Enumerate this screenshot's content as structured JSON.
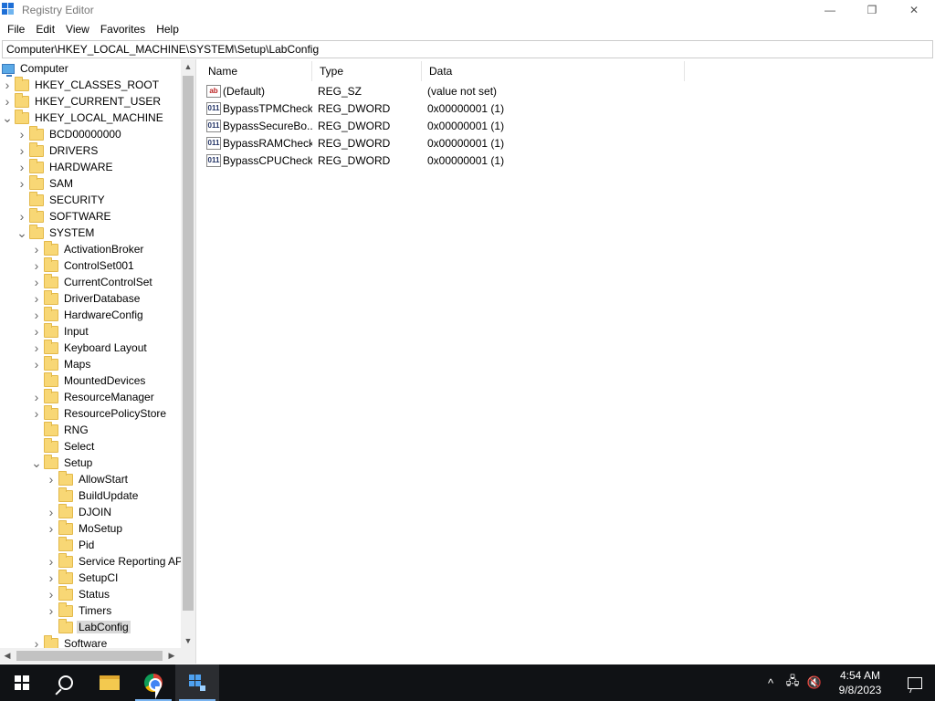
{
  "window": {
    "title": "Registry Editor",
    "minimize_glyph": "—",
    "maximize_glyph": "❐",
    "close_glyph": "✕"
  },
  "menu": [
    "File",
    "Edit",
    "View",
    "Favorites",
    "Help"
  ],
  "address": "Computer\\HKEY_LOCAL_MACHINE\\SYSTEM\\Setup\\LabConfig",
  "tree": [
    {
      "label": "Computer",
      "depth": 0,
      "icon": "computer-icon",
      "expander": "",
      "selected": false
    },
    {
      "label": "HKEY_CLASSES_ROOT",
      "depth": 1,
      "icon": "folder-icon",
      "expander": ">",
      "selected": false
    },
    {
      "label": "HKEY_CURRENT_USER",
      "depth": 1,
      "icon": "folder-icon",
      "expander": ">",
      "selected": false
    },
    {
      "label": "HKEY_LOCAL_MACHINE",
      "depth": 1,
      "icon": "folder-icon",
      "expander": "v",
      "selected": false
    },
    {
      "label": "BCD00000000",
      "depth": 2,
      "icon": "folder-icon",
      "expander": ">",
      "selected": false
    },
    {
      "label": "DRIVERS",
      "depth": 2,
      "icon": "folder-icon",
      "expander": ">",
      "selected": false
    },
    {
      "label": "HARDWARE",
      "depth": 2,
      "icon": "folder-icon",
      "expander": ">",
      "selected": false
    },
    {
      "label": "SAM",
      "depth": 2,
      "icon": "folder-icon",
      "expander": ">",
      "selected": false
    },
    {
      "label": "SECURITY",
      "depth": 2,
      "icon": "folder-icon",
      "expander": "",
      "selected": false
    },
    {
      "label": "SOFTWARE",
      "depth": 2,
      "icon": "folder-icon",
      "expander": ">",
      "selected": false
    },
    {
      "label": "SYSTEM",
      "depth": 2,
      "icon": "folder-icon",
      "expander": "v",
      "selected": false
    },
    {
      "label": "ActivationBroker",
      "depth": 3,
      "icon": "folder-icon",
      "expander": ">",
      "selected": false
    },
    {
      "label": "ControlSet001",
      "depth": 3,
      "icon": "folder-icon",
      "expander": ">",
      "selected": false
    },
    {
      "label": "CurrentControlSet",
      "depth": 3,
      "icon": "folder-icon",
      "expander": ">",
      "selected": false
    },
    {
      "label": "DriverDatabase",
      "depth": 3,
      "icon": "folder-icon",
      "expander": ">",
      "selected": false
    },
    {
      "label": "HardwareConfig",
      "depth": 3,
      "icon": "folder-icon",
      "expander": ">",
      "selected": false
    },
    {
      "label": "Input",
      "depth": 3,
      "icon": "folder-icon",
      "expander": ">",
      "selected": false
    },
    {
      "label": "Keyboard Layout",
      "depth": 3,
      "icon": "folder-icon",
      "expander": ">",
      "selected": false
    },
    {
      "label": "Maps",
      "depth": 3,
      "icon": "folder-icon",
      "expander": ">",
      "selected": false
    },
    {
      "label": "MountedDevices",
      "depth": 3,
      "icon": "folder-icon",
      "expander": "",
      "selected": false
    },
    {
      "label": "ResourceManager",
      "depth": 3,
      "icon": "folder-icon",
      "expander": ">",
      "selected": false
    },
    {
      "label": "ResourcePolicyStore",
      "depth": 3,
      "icon": "folder-icon",
      "expander": ">",
      "selected": false
    },
    {
      "label": "RNG",
      "depth": 3,
      "icon": "folder-icon",
      "expander": "",
      "selected": false
    },
    {
      "label": "Select",
      "depth": 3,
      "icon": "folder-icon",
      "expander": "",
      "selected": false
    },
    {
      "label": "Setup",
      "depth": 3,
      "icon": "folder-icon",
      "expander": "v",
      "selected": false
    },
    {
      "label": "AllowStart",
      "depth": 4,
      "icon": "folder-icon",
      "expander": ">",
      "selected": false
    },
    {
      "label": "BuildUpdate",
      "depth": 4,
      "icon": "folder-icon",
      "expander": "",
      "selected": false
    },
    {
      "label": "DJOIN",
      "depth": 4,
      "icon": "folder-icon",
      "expander": ">",
      "selected": false
    },
    {
      "label": "MoSetup",
      "depth": 4,
      "icon": "folder-icon",
      "expander": ">",
      "selected": false
    },
    {
      "label": "Pid",
      "depth": 4,
      "icon": "folder-icon",
      "expander": "",
      "selected": false
    },
    {
      "label": "Service Reporting API",
      "depth": 4,
      "icon": "folder-icon",
      "expander": ">",
      "selected": false
    },
    {
      "label": "SetupCI",
      "depth": 4,
      "icon": "folder-icon",
      "expander": ">",
      "selected": false
    },
    {
      "label": "Status",
      "depth": 4,
      "icon": "folder-icon",
      "expander": ">",
      "selected": false
    },
    {
      "label": "Timers",
      "depth": 4,
      "icon": "folder-icon",
      "expander": ">",
      "selected": false
    },
    {
      "label": "LabConfig",
      "depth": 4,
      "icon": "folder-icon",
      "expander": "",
      "selected": true
    },
    {
      "label": "Software",
      "depth": 3,
      "icon": "folder-icon",
      "expander": ">",
      "selected": false
    }
  ],
  "columns": {
    "name": "Name",
    "type": "Type",
    "data": "Data"
  },
  "values": [
    {
      "name": "(Default)",
      "type": "REG_SZ",
      "data": "(value not set)",
      "icon": "string-value-icon",
      "glyph": "ab"
    },
    {
      "name": "BypassTPMCheck",
      "type": "REG_DWORD",
      "data": "0x00000001 (1)",
      "icon": "binary-value-icon",
      "glyph": "011"
    },
    {
      "name": "BypassSecureBo...",
      "type": "REG_DWORD",
      "data": "0x00000001 (1)",
      "icon": "binary-value-icon",
      "glyph": "011"
    },
    {
      "name": "BypassRAMCheck",
      "type": "REG_DWORD",
      "data": "0x00000001 (1)",
      "icon": "binary-value-icon",
      "glyph": "011"
    },
    {
      "name": "BypassCPUCheck",
      "type": "REG_DWORD",
      "data": "0x00000001 (1)",
      "icon": "binary-value-icon",
      "glyph": "011"
    }
  ],
  "taskbar": {
    "apps": [
      "start-icon",
      "search-icon",
      "file-explorer-icon",
      "chrome-icon",
      "registry-editor-icon"
    ],
    "tray": {
      "overflow_glyph": "^",
      "network_glyph": "🖧",
      "volume_glyph": "🔇",
      "time": "4:54 AM",
      "date": "9/8/2023"
    }
  },
  "colors": {
    "taskbar_bg": "#101215",
    "selection_bg": "#d9d9d9",
    "folder": "#f8d775",
    "accent": "#1e6fd6"
  }
}
